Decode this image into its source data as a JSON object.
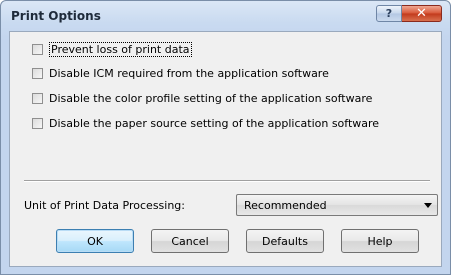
{
  "window": {
    "title": "Print Options",
    "help_glyph": "?",
    "close_glyph": "✕"
  },
  "options": [
    {
      "label": "Prevent loss of print data",
      "checked": false
    },
    {
      "label": "Disable ICM required from the application software",
      "checked": false
    },
    {
      "label": "Disable the color profile setting of the application software",
      "checked": false
    },
    {
      "label": "Disable the paper source setting of the application software",
      "checked": false
    }
  ],
  "unit": {
    "label": "Unit of Print Data Processing:",
    "selected": "Recommended"
  },
  "buttons": {
    "ok": "OK",
    "cancel": "Cancel",
    "defaults": "Defaults",
    "help": "Help"
  },
  "colors": {
    "default_button_border": "#3c7fb1",
    "close_button": "#c23a1c"
  }
}
